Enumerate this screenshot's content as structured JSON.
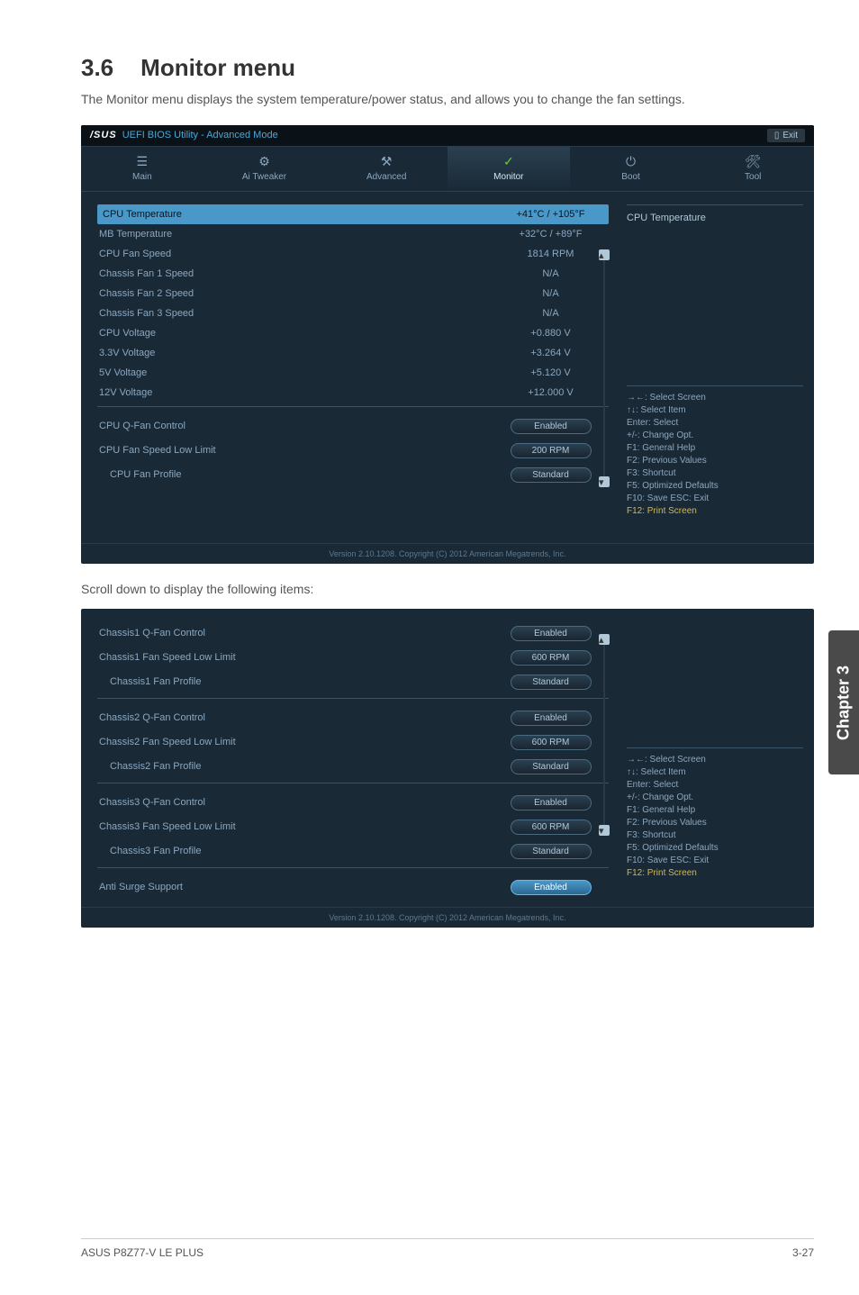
{
  "section": {
    "number": "3.6",
    "title": "Monitor menu",
    "description": "The Monitor menu displays the system temperature/power status, and allows you to change the fan settings."
  },
  "bios_header": {
    "brand": "/SUS",
    "title": "UEFI BIOS Utility - Advanced Mode",
    "exit": "Exit"
  },
  "tabs": [
    {
      "icon": "☰",
      "label": "Main"
    },
    {
      "icon": "⚙",
      "label": "Ai Tweaker"
    },
    {
      "icon": "⚒",
      "label": "Advanced"
    },
    {
      "icon": "✓",
      "label": "Monitor"
    },
    {
      "icon": "⏻",
      "label": "Boot"
    },
    {
      "icon": "🛠",
      "label": "Tool"
    }
  ],
  "panel1": {
    "rows": [
      {
        "label": "CPU Temperature",
        "value": "+41°C / +105°F",
        "highlighted": true
      },
      {
        "label": "MB Temperature",
        "value": "+32°C / +89°F"
      },
      {
        "label": "CPU Fan Speed",
        "value": "1814 RPM"
      },
      {
        "label": "Chassis Fan 1 Speed",
        "value": "N/A"
      },
      {
        "label": "Chassis Fan 2 Speed",
        "value": "N/A"
      },
      {
        "label": "Chassis Fan 3 Speed",
        "value": "N/A"
      },
      {
        "label": "CPU Voltage",
        "value": "+0.880 V"
      },
      {
        "label": "3.3V Voltage",
        "value": "+3.264 V"
      },
      {
        "label": "5V Voltage",
        "value": "+5.120 V"
      },
      {
        "label": "12V Voltage",
        "value": "+12.000 V"
      }
    ],
    "buttons": [
      {
        "label": "CPU Q-Fan Control",
        "value": "Enabled"
      },
      {
        "label": "CPU Fan Speed Low Limit",
        "value": "200 RPM"
      },
      {
        "label": "CPU Fan Profile",
        "value": "Standard",
        "indent": true
      }
    ],
    "help_title": "CPU Temperature",
    "footer": "Version 2.10.1208. Copyright (C) 2012 American Megatrends, Inc."
  },
  "help_text": {
    "lines": [
      "→←: Select Screen",
      "↑↓: Select Item",
      "Enter: Select",
      "+/-: Change Opt.",
      "F1: General Help",
      "F2: Previous Values",
      "F3: Shortcut",
      "F5: Optimized Defaults",
      "F10: Save  ESC: Exit",
      "F12: Print Screen"
    ]
  },
  "scroll_desc": "Scroll down to display the following items:",
  "panel2": {
    "groups": [
      [
        {
          "label": "Chassis1 Q-Fan Control",
          "value": "Enabled"
        },
        {
          "label": "Chassis1 Fan Speed Low Limit",
          "value": "600 RPM"
        },
        {
          "label": "Chassis1 Fan Profile",
          "value": "Standard",
          "indent": true
        }
      ],
      [
        {
          "label": "Chassis2 Q-Fan Control",
          "value": "Enabled"
        },
        {
          "label": "Chassis2 Fan Speed Low Limit",
          "value": "600 RPM"
        },
        {
          "label": "Chassis2 Fan Profile",
          "value": "Standard",
          "indent": true
        }
      ],
      [
        {
          "label": "Chassis3 Q-Fan Control",
          "value": "Enabled"
        },
        {
          "label": "Chassis3 Fan Speed Low Limit",
          "value": "600 RPM"
        },
        {
          "label": "Chassis3 Fan Profile",
          "value": "Standard",
          "indent": true
        }
      ]
    ],
    "last": {
      "label": "Anti Surge Support",
      "value": "Enabled",
      "active": true
    },
    "footer": "Version 2.10.1208. Copyright (C) 2012 American Megatrends, Inc."
  },
  "chapter_tab": "Chapter 3",
  "footer": {
    "left": "ASUS P8Z77-V LE PLUS",
    "right": "3-27"
  }
}
